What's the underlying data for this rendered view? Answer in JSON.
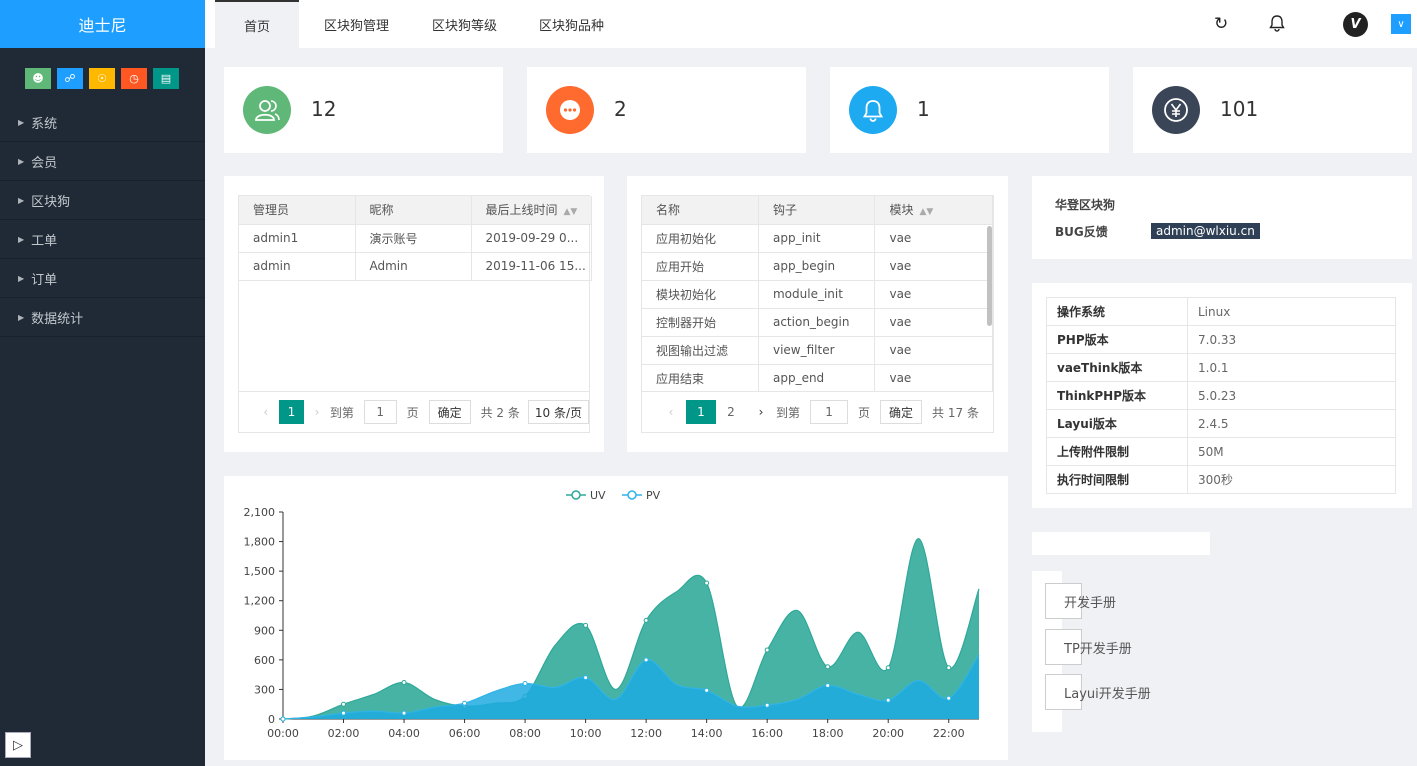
{
  "brand": "迪士尼",
  "sidebar": {
    "menu": [
      "系统",
      "会员",
      "区块狗",
      "工单",
      "订单",
      "数据统计"
    ]
  },
  "header": {
    "tabs": [
      "首页",
      "区块狗管理",
      "区块狗等级",
      "区块狗品种"
    ],
    "avatar_letter": "V"
  },
  "stats": [
    {
      "value": "12",
      "icon": "users-icon",
      "color": "#5fb878"
    },
    {
      "value": "2",
      "icon": "message-icon",
      "color": "#ff5722"
    },
    {
      "value": "1",
      "icon": "bell-icon",
      "color": "#1e9fff"
    },
    {
      "value": "101",
      "icon": "yen-icon",
      "color": "#2f4056"
    }
  ],
  "admin_table": {
    "headers": [
      "管理员",
      "昵称",
      "最后上线时间"
    ],
    "rows": [
      [
        "admin1",
        "演示账号",
        "2019-09-29 0..."
      ],
      [
        "admin",
        "Admin",
        "2019-11-06 15..."
      ]
    ],
    "pager": {
      "current": "1",
      "goto_label": "到第",
      "page_input": "1",
      "page_unit": "页",
      "confirm": "确定",
      "total": "共 2 条",
      "size": "10 条/页"
    }
  },
  "hook_table": {
    "headers": [
      "名称",
      "钩子",
      "模块"
    ],
    "rows": [
      [
        "应用初始化",
        "app_init",
        "vae"
      ],
      [
        "应用开始",
        "app_begin",
        "vae"
      ],
      [
        "模块初始化",
        "module_init",
        "vae"
      ],
      [
        "控制器开始",
        "action_begin",
        "vae"
      ],
      [
        "视图输出过滤",
        "view_filter",
        "vae"
      ],
      [
        "应用结束",
        "app_end",
        "vae"
      ]
    ],
    "pager": {
      "current": "1",
      "next": "2",
      "goto_label": "到第",
      "page_input": "1",
      "page_unit": "页",
      "confirm": "确定",
      "total": "共 17 条"
    }
  },
  "info": {
    "title": "华登区块狗",
    "bug_label": "BUG反馈",
    "bug_email": "admin@wlxiu.cn"
  },
  "system": [
    [
      "操作系统",
      "Linux"
    ],
    [
      "PHP版本",
      "7.0.33"
    ],
    [
      "vaeThink版本",
      "1.0.1"
    ],
    [
      "ThinkPHP版本",
      "5.0.23"
    ],
    [
      "Layui版本",
      "2.4.5"
    ],
    [
      "上传附件限制",
      "50M"
    ],
    [
      "执行时间限制",
      "300秒"
    ]
  ],
  "manuals": [
    "开发手册",
    "TP开发手册",
    "Layui开发手册"
  ],
  "colors": {
    "uv": "#2ea898",
    "pv": "#2fb4e8"
  },
  "chart_data": {
    "type": "area",
    "x": [
      "00:00",
      "01:00",
      "02:00",
      "03:00",
      "04:00",
      "05:00",
      "06:00",
      "07:00",
      "08:00",
      "09:00",
      "10:00",
      "11:00",
      "12:00",
      "13:00",
      "14:00",
      "15:00",
      "16:00",
      "17:00",
      "18:00",
      "19:00",
      "20:00",
      "21:00",
      "22:00",
      "23:00"
    ],
    "x_ticks": [
      "00:00",
      "02:00",
      "04:00",
      "06:00",
      "08:00",
      "10:00",
      "12:00",
      "14:00",
      "16:00",
      "18:00",
      "20:00",
      "22:00"
    ],
    "y_ticks": [
      "0",
      "300",
      "600",
      "900",
      "1,200",
      "1,500",
      "1,800",
      "2,100"
    ],
    "ylim": [
      0,
      2100
    ],
    "series": [
      {
        "name": "UV",
        "values": [
          0,
          30,
          150,
          250,
          370,
          200,
          130,
          160,
          230,
          750,
          950,
          300,
          1000,
          1290,
          1380,
          130,
          700,
          1100,
          530,
          880,
          520,
          1830,
          520,
          1320
        ]
      },
      {
        "name": "PV",
        "values": [
          0,
          20,
          60,
          80,
          60,
          120,
          160,
          280,
          360,
          320,
          420,
          200,
          600,
          350,
          290,
          130,
          140,
          200,
          340,
          250,
          190,
          390,
          210,
          650
        ]
      }
    ],
    "legend_position": "top-center"
  }
}
